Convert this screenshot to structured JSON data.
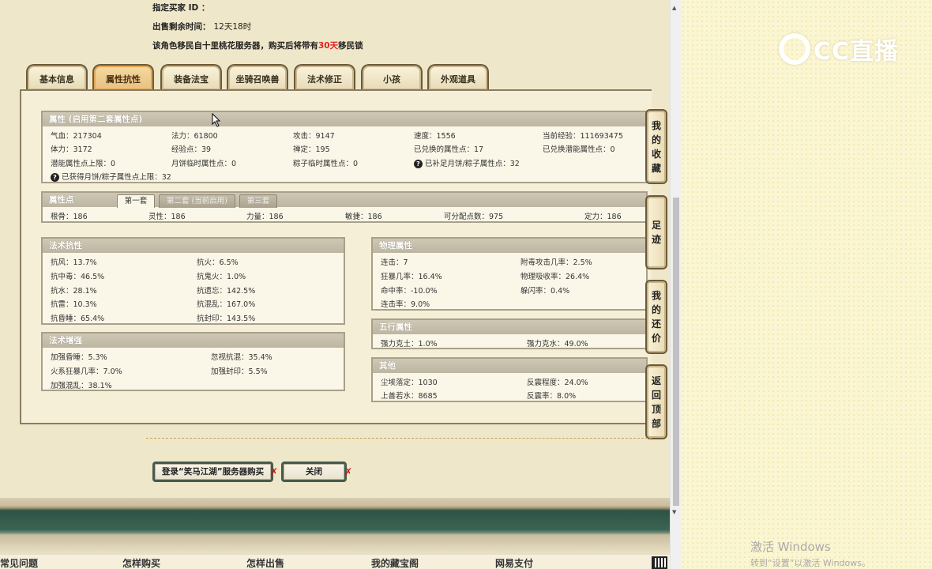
{
  "header": {
    "buyer_id_label": "指定买家 ID ：",
    "time_left_label": "出售剩余时间：",
    "time_left_value": "12天18时",
    "migrate_prefix": "该角色移民自十里桃花服务器，购买后将带有",
    "migrate_days": "30天",
    "migrate_suffix": "移民锁"
  },
  "tabs": [
    {
      "label": "基本信息",
      "active": false
    },
    {
      "label": "属性抗性",
      "active": true
    },
    {
      "label": "装备法宝",
      "active": false
    },
    {
      "label": "坐骑召唤兽",
      "active": false
    },
    {
      "label": "法术修正",
      "active": false
    },
    {
      "label": "小孩",
      "active": false
    },
    {
      "label": "外观道具",
      "active": false
    }
  ],
  "attributes": {
    "title": "属性 (启用第二套属性点)",
    "rows": [
      [
        "气血：217304",
        "法力：61800",
        "攻击：9147",
        "速度：1556",
        "当前经验：111693475"
      ],
      [
        "体力：3172",
        "经验点：39",
        "禅定：195",
        "已兑换的属性点：17",
        "已兑换潜能属性点：0"
      ],
      [
        "潜能属性点上限：0",
        "月饼临时属性点：0",
        "粽子临时属性点：0",
        "已补足月饼/粽子属性点：32",
        ""
      ]
    ],
    "note": "已获得月饼/粽子属性点上限：32",
    "q_glyph": "?"
  },
  "attr_points": {
    "title": "属性点",
    "subtabs": [
      "第一套",
      "第二套 (当前启用)",
      "第三套"
    ],
    "values": [
      "根骨：186",
      "灵性：186",
      "力量：186",
      "敏捷：186",
      "可分配点数：975",
      "定力：186"
    ]
  },
  "spell_resist": {
    "title": "法术抗性",
    "left": [
      "抗风：13.7%",
      "抗中毒：46.5%",
      "抗水：28.1%",
      "抗雷：10.3%",
      "抗昏睡：65.4%"
    ],
    "right": [
      "抗火：6.5%",
      "抗鬼火：1.0%",
      "抗遗忘：142.5%",
      "抗混乱：167.0%",
      "抗封印：143.5%"
    ]
  },
  "spell_boost": {
    "title": "法术增强",
    "left": [
      "加强昏睡：5.3%",
      "火系狂暴几率：7.0%",
      "加强混乱：38.1%"
    ],
    "right": [
      "忽视抗混：35.4%",
      "加强封印：5.5%"
    ]
  },
  "physical": {
    "title": "物理属性",
    "left": [
      "连击：7",
      "狂暴几率：16.4%",
      "命中率：-10.0%",
      "连击率：9.0%"
    ],
    "right": [
      "附毒攻击几率：2.5%",
      "物理吸收率：26.4%",
      "躲闪率：0.4%"
    ]
  },
  "wuxing": {
    "title": "五行属性",
    "left": [
      "强力克土：1.0%"
    ],
    "right": [
      "强力克水：49.0%"
    ]
  },
  "other": {
    "title": "其他",
    "left": [
      "尘埃落定：1030",
      "上善若水：8685"
    ],
    "right": [
      "反震程度：24.0%",
      "反震率：8.0%"
    ]
  },
  "sidenav": [
    {
      "label": "我的收藏",
      "chars": [
        "我",
        "的",
        "收",
        "藏"
      ]
    },
    {
      "label": "足迹",
      "chars": [
        "足",
        "迹"
      ]
    },
    {
      "label": "我的还价",
      "chars": [
        "我",
        "的",
        "还",
        "价"
      ]
    },
    {
      "label": "返回顶部",
      "chars": [
        "返",
        "回",
        "顶",
        "部"
      ]
    }
  ],
  "buttons": {
    "login_label": "登录“笑马江湖”服务器购买",
    "close_label": "关闭",
    "x_glyph": "✗"
  },
  "footer": [
    "常见问题",
    "怎样购买",
    "怎样出售",
    "我的藏宝阁",
    "网易支付"
  ],
  "watermark": {
    "text": "CC直播"
  },
  "activate": {
    "line1": "激活 Windows",
    "line2": "转到“设置”以激活 Windows。"
  },
  "scroll": {
    "up": "▲",
    "down": "▼"
  }
}
